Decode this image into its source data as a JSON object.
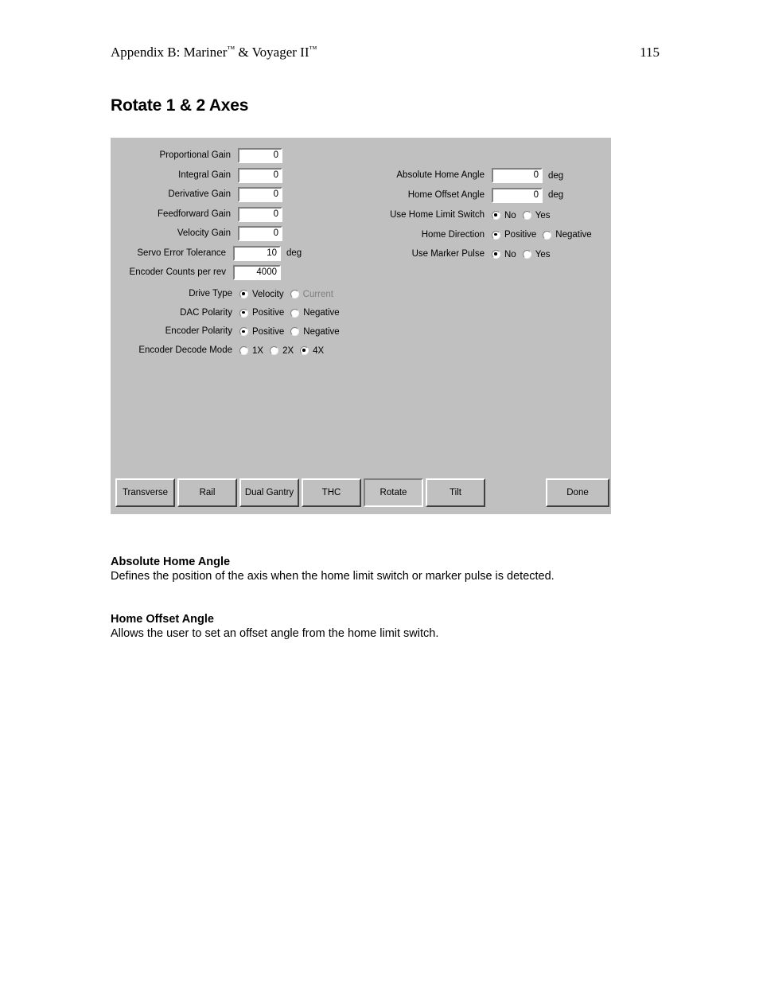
{
  "page": {
    "header_title": "Appendix B: Mariner™ & Voyager II™",
    "header_title_main": "Appendix B: Mariner",
    "header_tm1": "™",
    "header_title_mid": " & Voyager II",
    "header_tm2": "™",
    "page_number": "115",
    "heading": "Rotate 1 & 2 Axes"
  },
  "dialog": {
    "background_color": "#c0c0c0",
    "left_fields": [
      {
        "label": "Proportional Gain",
        "value": "0",
        "unit": ""
      },
      {
        "label": "Integral Gain",
        "value": "0",
        "unit": ""
      },
      {
        "label": "Derivative Gain",
        "value": "0",
        "unit": ""
      },
      {
        "label": "Feedforward Gain",
        "value": "0",
        "unit": ""
      },
      {
        "label": "Velocity Gain",
        "value": "0",
        "unit": ""
      },
      {
        "label": "Servo Error Tolerance",
        "value": "10",
        "unit": "deg"
      },
      {
        "label": "Encoder Counts per rev",
        "value": "4000",
        "unit": ""
      }
    ],
    "left_radios": [
      {
        "label": "Drive Type",
        "options": [
          {
            "text": "Velocity",
            "selected": true,
            "disabled": false
          },
          {
            "text": "Current",
            "selected": false,
            "disabled": true
          }
        ]
      },
      {
        "label": "DAC Polarity",
        "options": [
          {
            "text": "Positive",
            "selected": true,
            "disabled": false
          },
          {
            "text": "Negative",
            "selected": false,
            "disabled": false
          }
        ]
      },
      {
        "label": "Encoder Polarity",
        "options": [
          {
            "text": "Positive",
            "selected": true,
            "disabled": false
          },
          {
            "text": "Negative",
            "selected": false,
            "disabled": false
          }
        ]
      },
      {
        "label": "Encoder Decode Mode",
        "options": [
          {
            "text": "1X",
            "selected": false,
            "disabled": false
          },
          {
            "text": "2X",
            "selected": false,
            "disabled": false
          },
          {
            "text": "4X",
            "selected": true,
            "disabled": false
          }
        ]
      }
    ],
    "right_fields": [
      {
        "label": "Absolute Home Angle",
        "value": "0",
        "unit": "deg"
      },
      {
        "label": "Home Offset Angle",
        "value": "0",
        "unit": "deg"
      }
    ],
    "right_radios": [
      {
        "label": "Use Home Limit Switch",
        "options": [
          {
            "text": "No",
            "selected": true,
            "disabled": false
          },
          {
            "text": "Yes",
            "selected": false,
            "disabled": false
          }
        ]
      },
      {
        "label": "Home Direction",
        "options": [
          {
            "text": "Positive",
            "selected": true,
            "disabled": false
          },
          {
            "text": "Negative",
            "selected": false,
            "disabled": false
          }
        ]
      },
      {
        "label": "Use Marker Pulse",
        "options": [
          {
            "text": "No",
            "selected": true,
            "disabled": false
          },
          {
            "text": "Yes",
            "selected": false,
            "disabled": false
          }
        ]
      }
    ],
    "buttons": [
      {
        "label": "Transverse",
        "active": false
      },
      {
        "label": "Rail",
        "active": false
      },
      {
        "label": "Dual Gantry",
        "active": false
      },
      {
        "label": "THC",
        "active": false
      },
      {
        "label": "Rotate",
        "active": true
      },
      {
        "label": "Tilt",
        "active": false
      }
    ],
    "done_button": {
      "label": "Done",
      "active": false
    }
  },
  "definitions": [
    {
      "term": "Absolute Home Angle",
      "text": "Defines the position of the axis when the home limit switch or marker pulse is detected."
    },
    {
      "term": "Home Offset Angle",
      "text": "Allows the user to set an offset angle from the home limit switch."
    }
  ]
}
